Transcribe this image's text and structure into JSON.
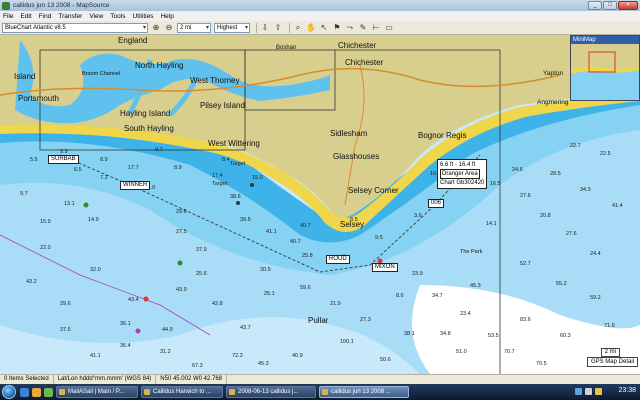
{
  "window": {
    "title": "callidus jun 13 2008 - MapSource",
    "buttons": [
      "_",
      "□",
      "×"
    ]
  },
  "menu": [
    "File",
    "Edit",
    "Find",
    "Transfer",
    "View",
    "Tools",
    "Utilities",
    "Help"
  ],
  "toolbar": {
    "map_product": "BlueChart Atlantic v8.5",
    "zoom_level": "2 mi",
    "detail_level": "Highest"
  },
  "map": {
    "places": [
      "England",
      "Boshan",
      "Chichester",
      "North Hayling",
      "West Thorney",
      "Chichester",
      "Pilsey Island",
      "Hayling Island",
      "South Hayling",
      "Portsmouth",
      "Island",
      "Broom Channel",
      "West Wittering",
      "Sidlesham",
      "Bognor Regis",
      "Glasshouses",
      "Selsey Corner",
      "Selsey",
      "Pullar",
      "Yapton",
      "Angmering",
      "The Park"
    ],
    "depths": [
      "9.9",
      "8.9",
      "9.7",
      "17.7",
      "11.0",
      "29.6",
      "38.6",
      "27.5",
      "37.9",
      "40.7",
      "25.8",
      "17.4",
      "39.5",
      "30.5",
      "43.9",
      "42.8",
      "43.7",
      "59.6",
      "43.4",
      "32.0",
      "22.0",
      "44.9",
      "45.3",
      "37.5",
      "72.3",
      "100.1",
      "67.3",
      "8.5",
      "9.5",
      "3.6",
      "23.9",
      "34.7",
      "23.4",
      "14.1",
      "16.5",
      "27.6",
      "20.8",
      "27.6",
      "24.4",
      "16.4",
      "24.6",
      "28.5",
      "34.3",
      "41.4",
      "22.5",
      "22.7",
      "52.7",
      "55.2",
      "59.2",
      "45.3",
      "83.6",
      "53.5",
      "60.3",
      "71.6",
      "70.7",
      "51.0",
      "38.1",
      "50.6",
      "70.5",
      "40.7",
      "41.1",
      "7.2",
      "6.5",
      "8.9",
      "13.1",
      "15.9",
      "5.5",
      "9.7",
      "14.9",
      "8.4",
      "15.0",
      "25.6",
      "25.1",
      "36.4",
      "31.2",
      "40.9",
      "21.9",
      "27.3",
      "41.1",
      "43.2",
      "29.6",
      "34.8",
      "36.1",
      "8.6"
    ],
    "waypoints": [
      "SURBAB",
      "WINNER",
      "ROUD",
      "MIXON",
      "Target",
      "Target"
    ],
    "route_code": "006",
    "tooltip": {
      "line1": "6.6 ft - 16.4 ft",
      "line2": "Dranger Area",
      "line3": "Chart Gb302420"
    },
    "scale": "2 mi",
    "detail_label": "GPS Map Detail",
    "minimap_title": "MiniMap"
  },
  "statusbar": {
    "selection": "0 Items Selected",
    "format": "Lat/Lon hddd°mm.mmm' (WGS 84)",
    "position": "N50 45.002 W0 42.768"
  },
  "taskbar": {
    "items": [
      "MailASail | Main / P...",
      "Callidus Harwich to ...",
      "2008-06-13 callidus j...",
      "callidus jun 13 2008 ..."
    ],
    "active_index": 3,
    "clock": "23:38"
  },
  "colors": {
    "land": "#d8cf8e",
    "beach": "#f0d64a",
    "shallow": "#3eb3e9",
    "mid": "#86d2f3",
    "deep": "#c7e9fa",
    "deepest": "#ffffff"
  }
}
